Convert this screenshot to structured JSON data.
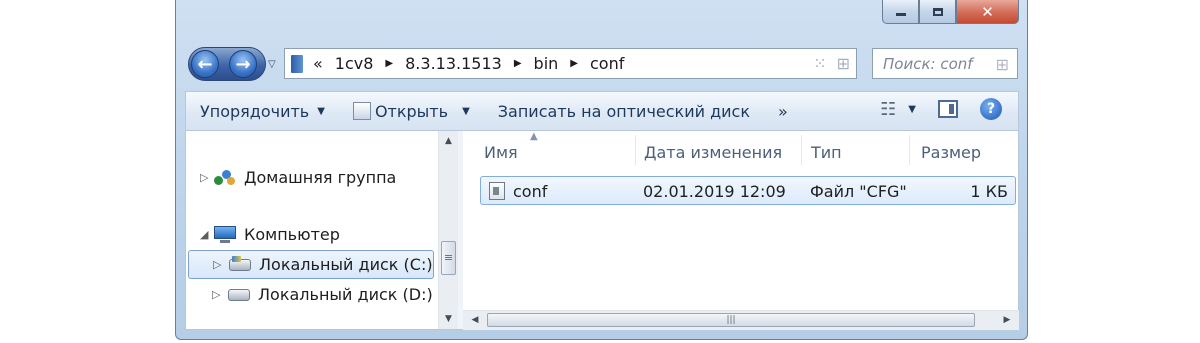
{
  "window": {
    "caption": {
      "minimize": "minimize-icon",
      "maximize": "maximize-icon",
      "close": "close-icon"
    }
  },
  "nav": {
    "back_icon": "back-arrow-icon",
    "forward_icon": "forward-arrow-icon"
  },
  "address": {
    "overflow": "«",
    "crumbs": [
      "1cv8",
      "8.3.13.1513",
      "bin",
      "conf"
    ]
  },
  "search": {
    "placeholder": "Поиск: conf"
  },
  "toolbar": {
    "organize": "Упорядочить",
    "open": "Открыть",
    "burn": "Записать на оптический диск",
    "more": "»"
  },
  "sidebar": {
    "items": [
      {
        "label": "Домашняя группа",
        "icon": "homegroup-icon"
      },
      {
        "label": "Компьютер",
        "icon": "computer-icon"
      },
      {
        "label": "Локальный диск (C:)",
        "icon": "system-drive-icon"
      },
      {
        "label": "Локальный диск (D:)",
        "icon": "drive-icon"
      }
    ]
  },
  "columns": {
    "name": "Имя",
    "date": "Дата изменения",
    "type": "Тип",
    "size": "Размер"
  },
  "files": [
    {
      "name": "conf",
      "date": "02.01.2019 12:09",
      "type": "Файл \"CFG\"",
      "size": "1 КБ"
    }
  ]
}
